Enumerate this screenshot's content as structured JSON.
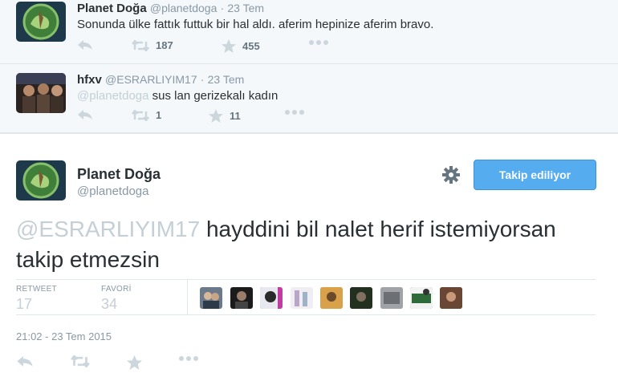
{
  "tweets": [
    {
      "name": "Planet Doğa",
      "handle": "@planetdoga",
      "time": "23 Tem",
      "text": "Sonunda ülke fattık futtuk bir hal aldı. aferim hepinize aferim bravo.",
      "retweets": "187",
      "likes": "455"
    },
    {
      "name": "hfxv",
      "handle": "@ESRARLIYIM17",
      "time": "23 Tem",
      "mention": "@planetdoga",
      "text": "sus lan gerizekalı kadın",
      "retweets": "1",
      "likes": "11"
    }
  ],
  "main": {
    "name": "Planet Doğa",
    "handle": "@planetdoga",
    "follow_label": "Takip ediliyor",
    "mention": "@ESRARLIYIM17",
    "text": " hayddini bil nalet herif istemiyorsan takip etmezsin",
    "retweet_label": "RETWEET",
    "retweet_count": "17",
    "favorite_label": "FAVORİ",
    "favorite_count": "34",
    "timestamp": "21:02 - 23 Tem 2015"
  },
  "dot": "·",
  "icons": [
    "reply-icon",
    "retweet-icon",
    "star-icon",
    "more-icon",
    "gear-icon"
  ],
  "colors": {
    "accent": "#55acee",
    "muted": "#8899a6",
    "icon": "#ccd6dd",
    "context_bg": "#f5f8fa"
  }
}
